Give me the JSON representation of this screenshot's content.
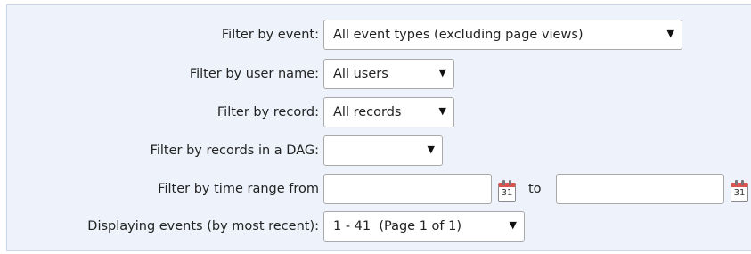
{
  "filters": {
    "event": {
      "label": "Filter by event:",
      "selected": "All event types (excluding page views)"
    },
    "user": {
      "label": "Filter by user name:",
      "selected": "All users"
    },
    "record": {
      "label": "Filter by record:",
      "selected": "All records"
    },
    "dag": {
      "label": "Filter by records in a DAG:",
      "selected": ""
    },
    "time": {
      "label": "Filter by time range from",
      "from_value": "",
      "to_label": "to",
      "to_value": "",
      "calendar_day": "31"
    },
    "display": {
      "label": "Displaying events (by most recent):",
      "selected": "1 - 41  (Page 1 of 1)"
    }
  },
  "icons": {
    "dropdown": "caret-down-icon",
    "calendar": "calendar-icon"
  },
  "colors": {
    "panel_bg": "#eef3fb",
    "panel_border": "#c9d6ea",
    "calendar_accent": "#d9534f"
  }
}
